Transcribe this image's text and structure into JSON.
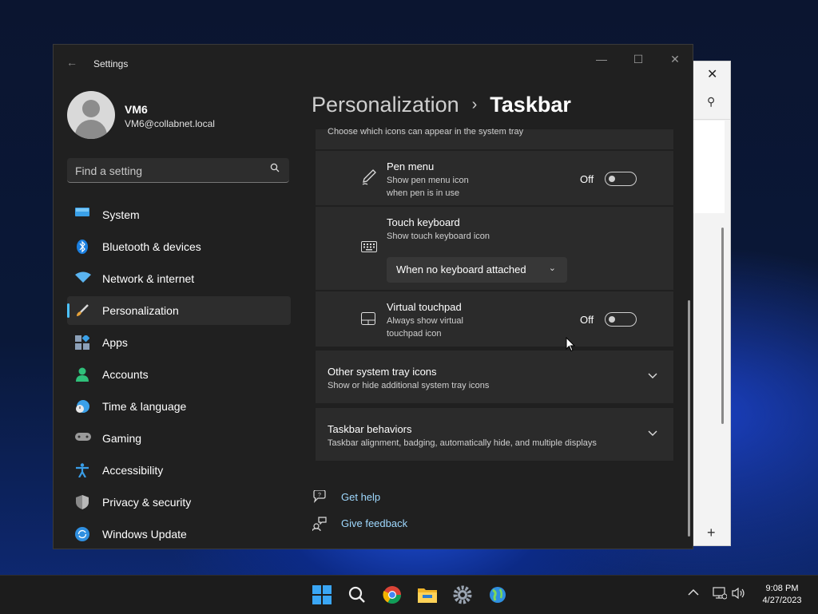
{
  "window": {
    "title": "Settings",
    "minimize": "—",
    "maximize": "☐",
    "close": "✕",
    "back": "←"
  },
  "user": {
    "name": "VM6",
    "email": "VM6@collabnet.local"
  },
  "search": {
    "placeholder": "Find a setting",
    "icon": "search-icon"
  },
  "nav": [
    {
      "label": "System",
      "icon": "system-icon",
      "color": "#3aa0e8"
    },
    {
      "label": "Bluetooth & devices",
      "icon": "bluetooth-icon",
      "color": "#1a7fe0"
    },
    {
      "label": "Network & internet",
      "icon": "wifi-icon",
      "color": "#5ab4f0"
    },
    {
      "label": "Personalization",
      "icon": "brush-icon",
      "color": "#e6a23a",
      "selected": true
    },
    {
      "label": "Apps",
      "icon": "apps-icon",
      "color": "#8ca0b8"
    },
    {
      "label": "Accounts",
      "icon": "accounts-icon",
      "color": "#2fc07a"
    },
    {
      "label": "Time & language",
      "icon": "clock-globe-icon",
      "color": "#3aa0e8"
    },
    {
      "label": "Gaming",
      "icon": "gamepad-icon",
      "color": "#9a9a9a"
    },
    {
      "label": "Accessibility",
      "icon": "accessibility-icon",
      "color": "#3a9ee8"
    },
    {
      "label": "Privacy & security",
      "icon": "shield-icon",
      "color": "#8a8a8a"
    },
    {
      "label": "Windows Update",
      "icon": "update-icon",
      "color": "#2f8fe0"
    }
  ],
  "breadcrumb": {
    "parent": "Personalization",
    "separator": "›",
    "current": "Taskbar"
  },
  "tray_section": {
    "partial_text": "Choose which icons can appear in the system tray"
  },
  "pen_menu": {
    "title": "Pen menu",
    "desc": "Show pen menu icon when pen is in use",
    "state": "Off"
  },
  "touch_keyboard": {
    "title": "Touch keyboard",
    "desc": "Show touch keyboard icon",
    "dropdown_value": "When no keyboard attached"
  },
  "virtual_touchpad": {
    "title": "Virtual touchpad",
    "desc": "Always show virtual touchpad icon",
    "state": "Off"
  },
  "other_tray": {
    "title": "Other system tray icons",
    "desc": "Show or hide additional system tray icons"
  },
  "behaviors": {
    "title": "Taskbar behaviors",
    "desc": "Taskbar alignment, badging, automatically hide, and multiple displays"
  },
  "help": {
    "get_help": "Get help",
    "give_feedback": "Give feedback"
  },
  "taskbar": {
    "apps": [
      "start-icon",
      "search-icon",
      "chrome-icon",
      "file-explorer-icon",
      "settings-icon",
      "globe-app-icon"
    ],
    "time": "9:08 PM",
    "date": "4/27/2023"
  }
}
